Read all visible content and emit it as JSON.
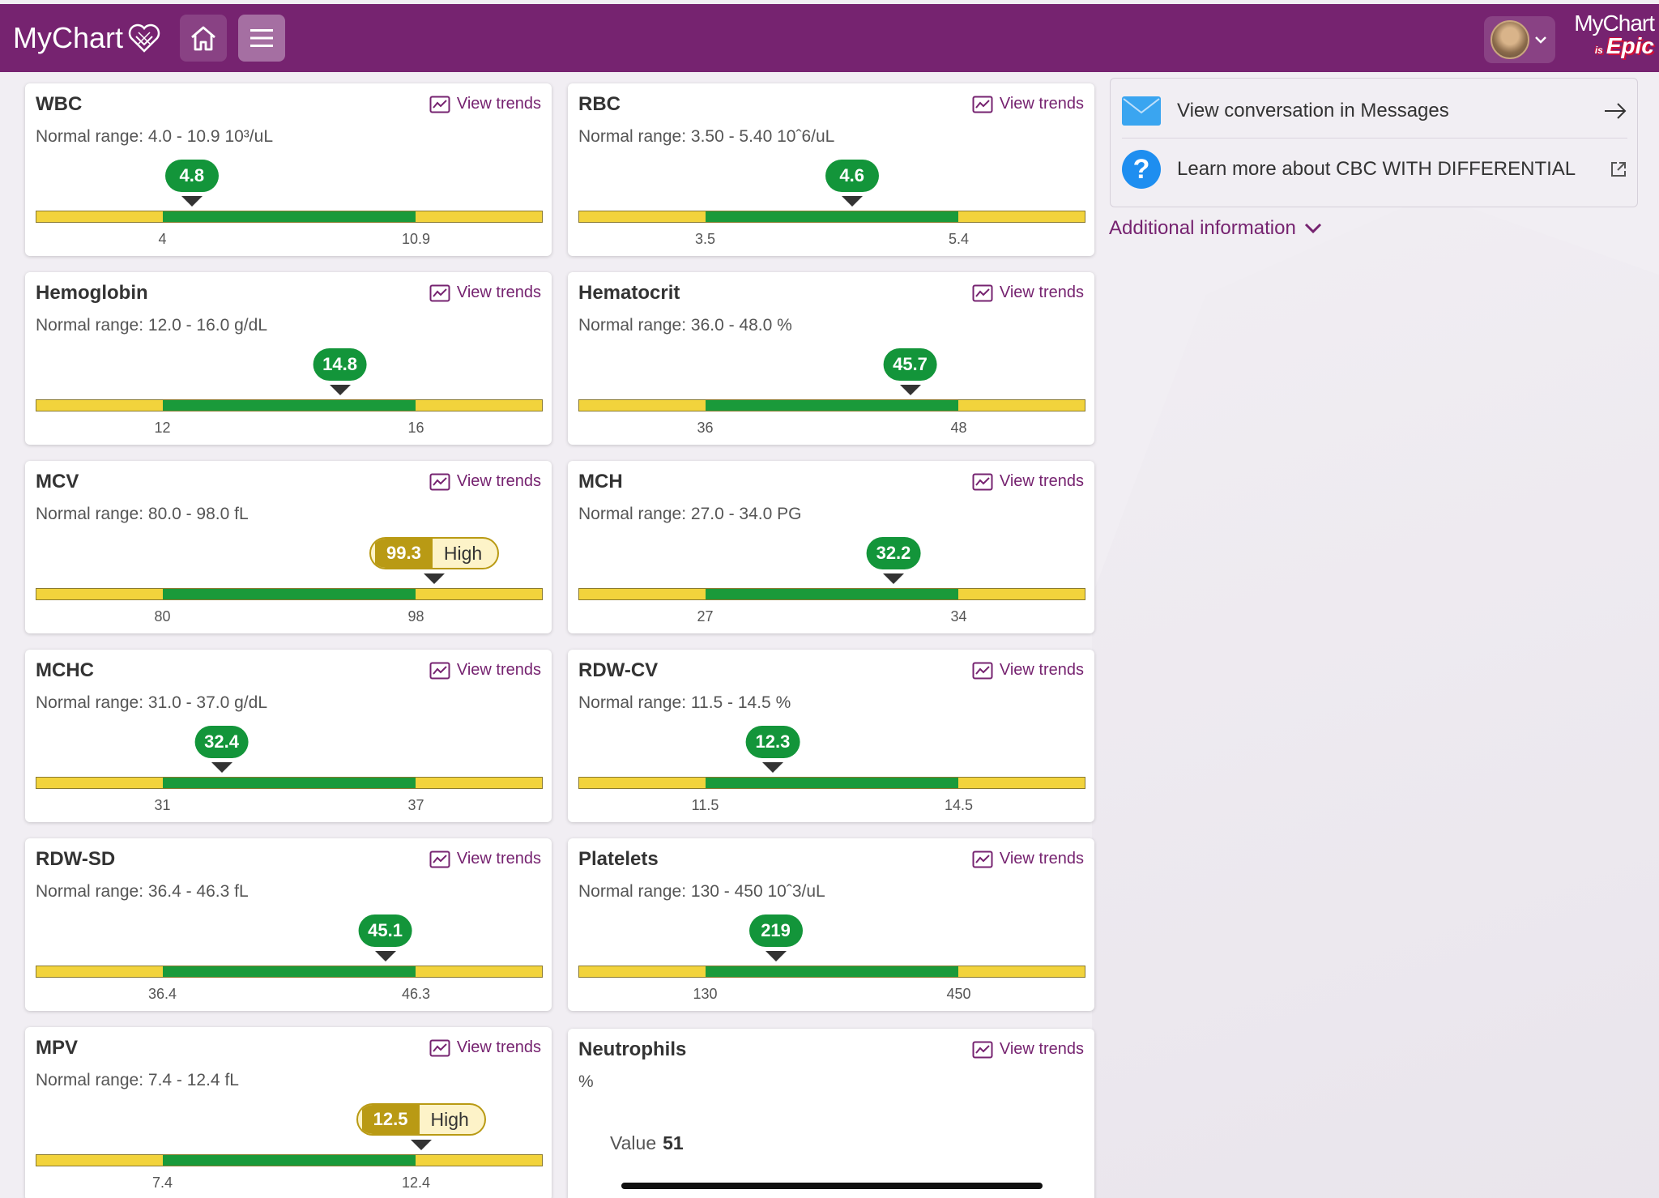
{
  "header": {
    "logo_text": "MyChart",
    "epic_line1": "MyChart",
    "epic_is": "is",
    "epic_line2": "Epic",
    "brand_color": "#762370"
  },
  "cards": [
    {
      "title": "WBC",
      "trends": "View trends",
      "range": "Normal range: 4.0 - 10.9 10³/uL",
      "value": "4.8",
      "flag": "",
      "low": "4",
      "high": "10.9"
    },
    {
      "title": "RBC",
      "trends": "View trends",
      "range": "Normal range: 3.50 - 5.40 10ˆ6/uL",
      "value": "4.6",
      "flag": "",
      "low": "3.5",
      "high": "5.4"
    },
    {
      "title": "Hemoglobin",
      "trends": "View trends",
      "range": "Normal range: 12.0 - 16.0 g/dL",
      "value": "14.8",
      "flag": "",
      "low": "12",
      "high": "16"
    },
    {
      "title": "Hematocrit",
      "trends": "View trends",
      "range": "Normal range: 36.0 - 48.0 %",
      "value": "45.7",
      "flag": "",
      "low": "36",
      "high": "48"
    },
    {
      "title": "MCV",
      "trends": "View trends",
      "range": "Normal range: 80.0 - 98.0 fL",
      "value": "99.3",
      "flag": "High",
      "low": "80",
      "high": "98"
    },
    {
      "title": "MCH",
      "trends": "View trends",
      "range": "Normal range: 27.0 - 34.0 PG",
      "value": "32.2",
      "flag": "",
      "low": "27",
      "high": "34"
    },
    {
      "title": "MCHC",
      "trends": "View trends",
      "range": "Normal range: 31.0 - 37.0 g/dL",
      "value": "32.4",
      "flag": "",
      "low": "31",
      "high": "37"
    },
    {
      "title": "RDW-CV",
      "trends": "View trends",
      "range": "Normal range: 11.5 - 14.5 %",
      "value": "12.3",
      "flag": "",
      "low": "11.5",
      "high": "14.5"
    },
    {
      "title": "RDW-SD",
      "trends": "View trends",
      "range": "Normal range: 36.4 - 46.3 fL",
      "value": "45.1",
      "flag": "",
      "low": "36.4",
      "high": "46.3"
    },
    {
      "title": "Platelets",
      "trends": "View trends",
      "range": "Normal range: 130 - 450 10ˆ3/uL",
      "value": "219",
      "flag": "",
      "low": "130",
      "high": "450"
    },
    {
      "title": "MPV",
      "trends": "View trends",
      "range": "Normal range: 7.4 - 12.4 fL",
      "value": "12.5",
      "flag": "High",
      "low": "7.4",
      "high": "12.4"
    }
  ],
  "neutrophils": {
    "title": "Neutrophils",
    "trends": "View trends",
    "unit": "%",
    "value_label": "Value",
    "value": "51"
  },
  "side": {
    "messages_label": "View conversation in Messages",
    "learn_label": "Learn more about CBC WITH DIFFERENTIAL",
    "additional_info": "Additional information"
  }
}
